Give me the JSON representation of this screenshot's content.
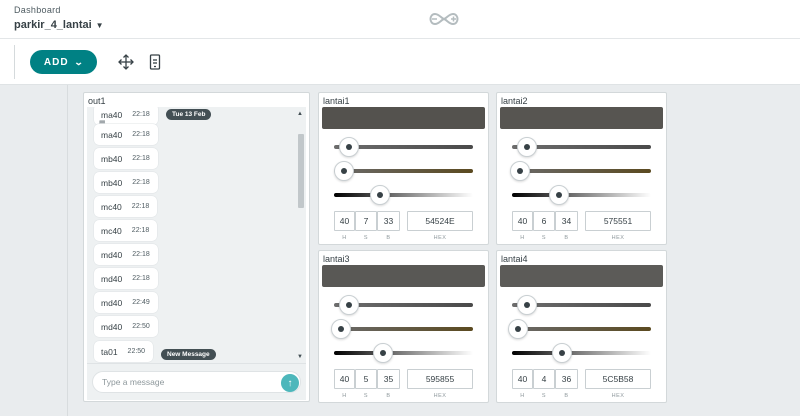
{
  "header": {
    "breadcrumb": "Dashboard",
    "dashboard_name": "parkir_4_lantai",
    "logo_icon": "arduino-infinity-icon"
  },
  "toolbar": {
    "add_label": "ADD",
    "move_icon": "move-arrows-icon",
    "mobile_icon": "mobile-view-icon"
  },
  "messenger": {
    "title": "out1",
    "date_pill": "Tue 13 Feb",
    "new_message_pill": "New Message",
    "placeholder": "Type a message",
    "messages": [
      {
        "text": "ma40",
        "time": "22:18"
      },
      {
        "text": "ma40",
        "time": "22:18"
      },
      {
        "text": "mb40",
        "time": "22:18"
      },
      {
        "text": "mb40",
        "time": "22:18"
      },
      {
        "text": "mc40",
        "time": "22:18"
      },
      {
        "text": "mc40",
        "time": "22:18"
      },
      {
        "text": "md40",
        "time": "22:18"
      },
      {
        "text": "md40",
        "time": "22:18"
      },
      {
        "text": "md40",
        "time": "22:49"
      },
      {
        "text": "md40",
        "time": "22:50"
      },
      {
        "text": "ta01",
        "time": "22:50"
      }
    ]
  },
  "pickers": [
    {
      "title": "lantai1",
      "h": "40",
      "s": "7",
      "b": "33",
      "hex": "54524E",
      "color": "#54524E"
    },
    {
      "title": "lantai2",
      "h": "40",
      "s": "6",
      "b": "34",
      "hex": "575551",
      "color": "#575551"
    },
    {
      "title": "lantai3",
      "h": "40",
      "s": "5",
      "b": "35",
      "hex": "595855",
      "color": "#595855"
    },
    {
      "title": "lantai4",
      "h": "40",
      "s": "4",
      "b": "36",
      "hex": "5C5B58",
      "color": "#5C5B58"
    }
  ],
  "labels": {
    "h": "H",
    "s": "S",
    "b": "B",
    "hex": "HEX"
  },
  "colors": {
    "accent": "#008184",
    "send": "#4db7bb",
    "pill": "#434f54"
  }
}
